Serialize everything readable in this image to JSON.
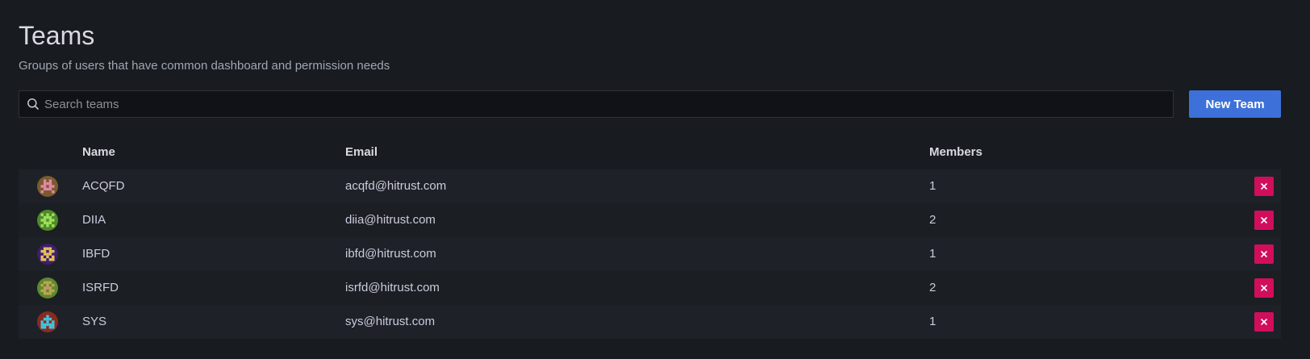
{
  "header": {
    "title": "Teams",
    "subtitle": "Groups of users that have common dashboard and permission needs"
  },
  "search": {
    "placeholder": "Search teams",
    "value": "",
    "icon": "search-icon"
  },
  "actions": {
    "new_team_label": "New Team"
  },
  "table": {
    "columns": {
      "name": "Name",
      "email": "Email",
      "members": "Members"
    },
    "rows": [
      {
        "avatar_colors": [
          "#7a5b2e",
          "#e08aa8"
        ],
        "name": "ACQFD",
        "email": "acqfd@hitrust.com",
        "members": "1"
      },
      {
        "avatar_colors": [
          "#4f8a2a",
          "#9ee05a"
        ],
        "name": "DIIA",
        "email": "diia@hitrust.com",
        "members": "2"
      },
      {
        "avatar_colors": [
          "#3d1f6b",
          "#e8c25a"
        ],
        "name": "IBFD",
        "email": "ibfd@hitrust.com",
        "members": "1"
      },
      {
        "avatar_colors": [
          "#5c8a2a",
          "#c2a05e"
        ],
        "name": "ISRFD",
        "email": "isrfd@hitrust.com",
        "members": "2"
      },
      {
        "avatar_colors": [
          "#8a2a1f",
          "#3ec6e0"
        ],
        "name": "SYS",
        "email": "sys@hitrust.com",
        "members": "1"
      }
    ]
  },
  "colors": {
    "background": "#181b1f",
    "primary_button": "#3d71d9",
    "delete_button": "#d10e5c"
  }
}
